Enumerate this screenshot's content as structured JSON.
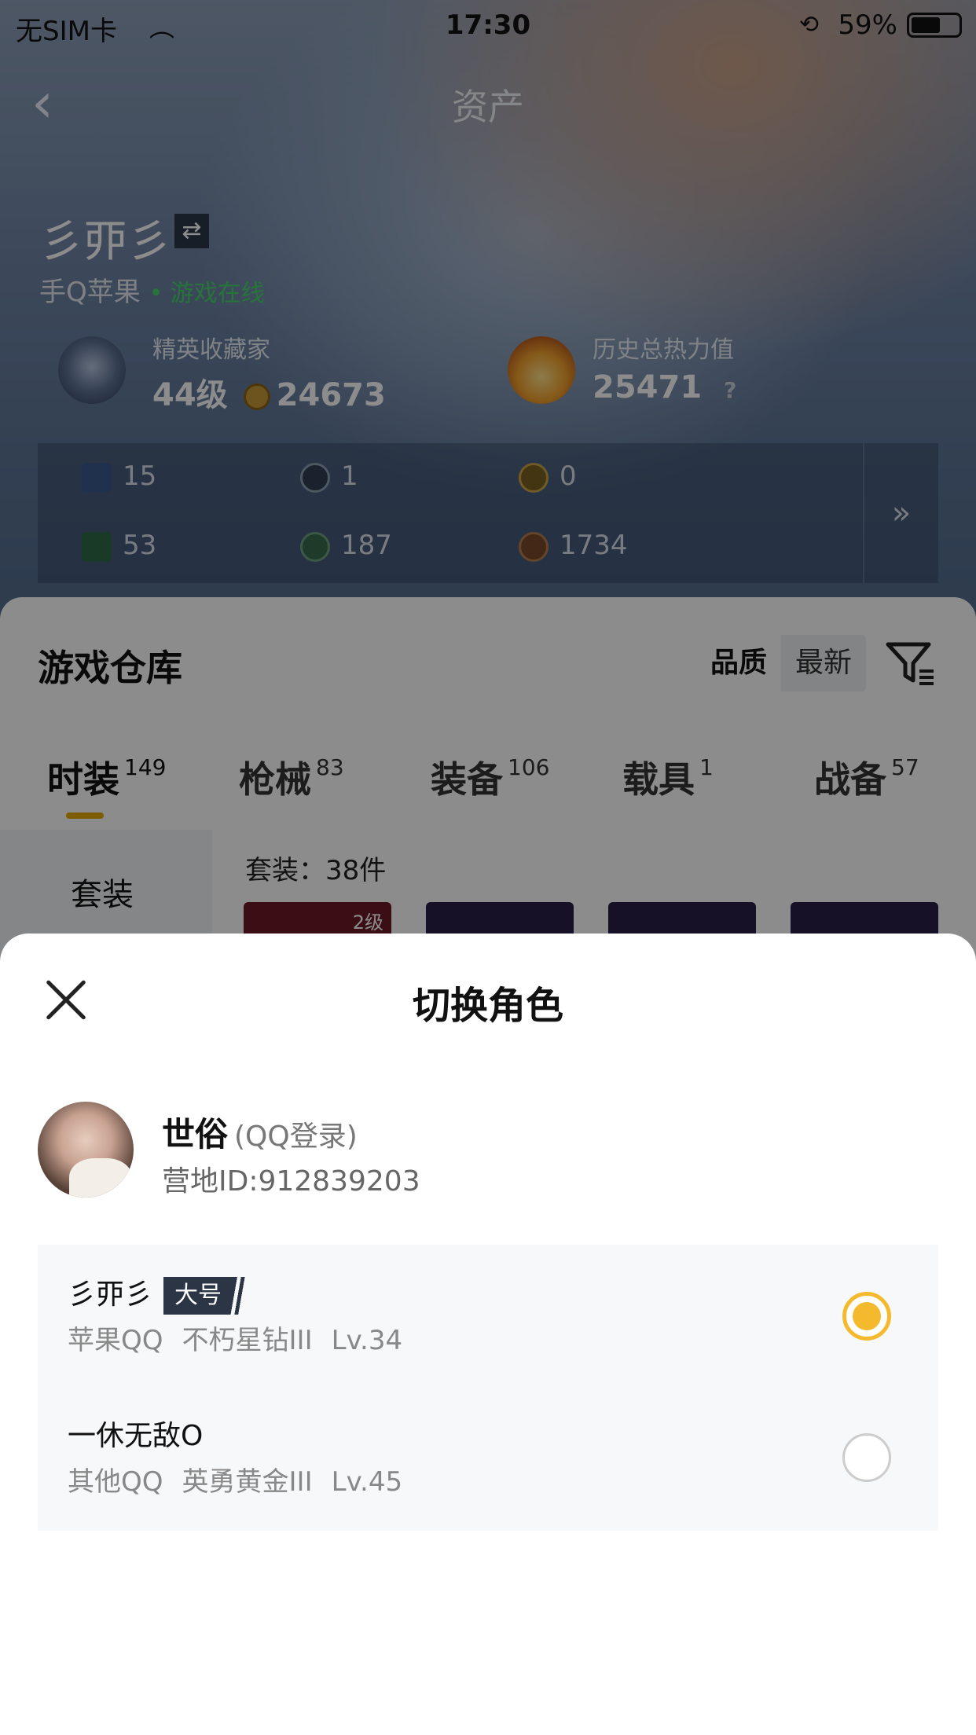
{
  "status_bar": {
    "carrier": "无SIM卡",
    "time": "17:30",
    "battery": "59%"
  },
  "nav": {
    "title": "资产"
  },
  "profile": {
    "name": "彡丣彡",
    "platform": "手Q苹果",
    "status": "• 游戏在线"
  },
  "stats": {
    "collector_label": "精英收藏家",
    "collector_level": "44级",
    "collector_points": "24673",
    "heat_label": "历史总热力值",
    "heat_value": "25471",
    "heat_help": "?"
  },
  "resources": [
    {
      "value": "15",
      "color": "#3a5a8a"
    },
    {
      "value": "1",
      "color": "#2f3f52"
    },
    {
      "value": "0",
      "color": "#7a6220"
    },
    {
      "value": "53",
      "color": "#2f6b46"
    },
    {
      "value": "187",
      "color": "#3a6a4a"
    },
    {
      "value": "1734",
      "color": "#7a4a2a"
    }
  ],
  "resources_more": "»",
  "warehouse": {
    "title": "游戏仓库",
    "sort_options": [
      "品质",
      "最新"
    ],
    "tabs": [
      {
        "label": "时装",
        "count": "149"
      },
      {
        "label": "枪械",
        "count": "83"
      },
      {
        "label": "装备",
        "count": "106"
      },
      {
        "label": "载具",
        "count": "1"
      },
      {
        "label": "战备",
        "count": "57"
      }
    ],
    "sub_category": "套装",
    "set_count": "套装：38件",
    "thumb_level": "2级"
  },
  "sheet": {
    "title": "切换角色",
    "user_name": "世俗",
    "login_type": "(QQ登录)",
    "camp_id": "营地ID:912839203",
    "roles": [
      {
        "name": "彡丣彡",
        "tag": "大号",
        "platform": "苹果QQ",
        "rank": "不朽星钻III",
        "level": "Lv.34",
        "selected": true
      },
      {
        "name": "一休无敌O",
        "tag": "",
        "platform": "其他QQ",
        "rank": "英勇黄金III",
        "level": "Lv.45",
        "selected": false
      }
    ]
  },
  "colors": {
    "accent": "#f5b92e",
    "tab_underline": "#e6a800",
    "online": "#47d36c"
  }
}
